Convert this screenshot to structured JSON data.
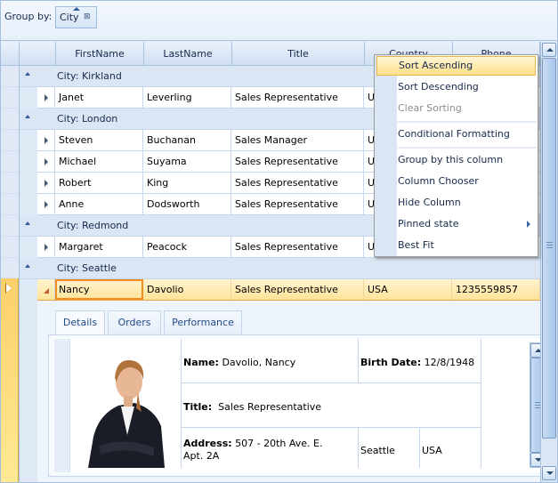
{
  "groupby": {
    "label": "Group by:",
    "chips": [
      {
        "label": "City",
        "sort": "ascending",
        "remove_icon": "close-icon"
      }
    ]
  },
  "columns": [
    "FirstName",
    "LastName",
    "Title",
    "Country",
    "Phone"
  ],
  "groups": [
    {
      "label": "City: Kirkland",
      "rows": [
        {
          "first": "Janet",
          "last": "Leverling",
          "title": "Sales Representative",
          "country": "U"
        }
      ]
    },
    {
      "label": "City: London",
      "rows": [
        {
          "first": "Steven",
          "last": "Buchanan",
          "title": "Sales Manager",
          "country": "U"
        },
        {
          "first": "Michael",
          "last": "Suyama",
          "title": "Sales Representative",
          "country": "U"
        },
        {
          "first": "Robert",
          "last": "King",
          "title": "Sales Representative",
          "country": "U"
        },
        {
          "first": "Anne",
          "last": "Dodsworth",
          "title": "Sales Representative",
          "country": "U"
        }
      ]
    },
    {
      "label": "City: Redmond",
      "rows": [
        {
          "first": "Margaret",
          "last": "Peacock",
          "title": "Sales Representative",
          "country": "U"
        }
      ]
    },
    {
      "label": "City: Seattle",
      "rows": [
        {
          "first": "Nancy",
          "last": "Davolio",
          "title": "Sales Representative",
          "country": "USA",
          "phone": "1235559857"
        }
      ]
    }
  ],
  "detail": {
    "tabs": [
      "Details",
      "Orders",
      "Performance"
    ],
    "active_tab": "Details",
    "name_label": "Name:",
    "name_value": "Davolio, Nancy",
    "birth_label": "Birth Date:",
    "birth_value": "12/8/1948",
    "title_label": "Title:",
    "title_value": "Sales Representative",
    "address_label": "Address:",
    "address_value": "507 - 20th Ave. E.",
    "address_line2": "Apt. 2A",
    "city": "Seattle",
    "country": "USA"
  },
  "context_menu": {
    "items": [
      {
        "label": "Sort Ascending",
        "state": "highlighted"
      },
      {
        "label": "Sort Descending"
      },
      {
        "label": "Clear Sorting",
        "state": "disabled"
      },
      {
        "label": "Conditional Formatting"
      },
      {
        "label": "Group by this column"
      },
      {
        "label": "Column Chooser"
      },
      {
        "label": "Hide Column"
      },
      {
        "label": "Pinned state",
        "submenu": true
      },
      {
        "label": "Best Fit"
      }
    ]
  },
  "colors": {
    "selection": "#ffe39a",
    "current_cell_border": "#f28c1e",
    "header_text": "#15294b",
    "grid_line": "#c6d7ec"
  }
}
